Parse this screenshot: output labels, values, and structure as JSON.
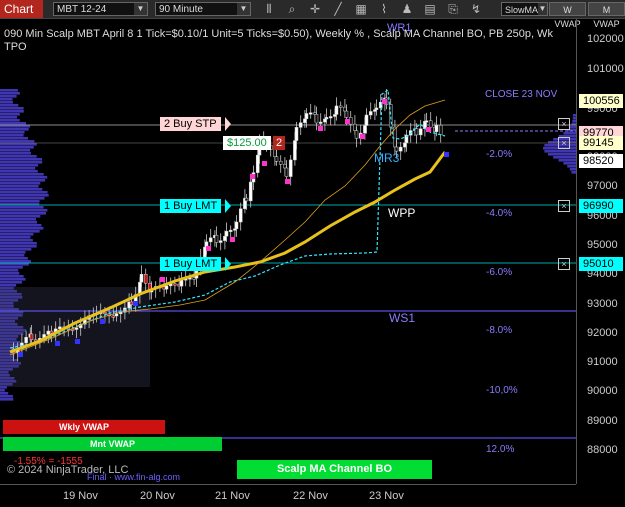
{
  "toolbar": {
    "chart_tab": "Chart",
    "instrument": "MBT 12-24",
    "interval": "90 Minute",
    "slow_ma": "SlowMA",
    "w_vwap": "W VWAP",
    "m_vwap": "M VWAP"
  },
  "title": {
    "line1": "090 Min Scalp MBT April 8 1 Tick=$0.10/1 Unit=5 Ticks=$0.50), Weekly % , Scalp MA Channel BO, PB 250p, Wk",
    "line2": "TPO"
  },
  "price_axis": {
    "labels": [
      "102000",
      "101000",
      "99000",
      "98000",
      "97000",
      "96000",
      "95000",
      "94000",
      "93000",
      "92000",
      "91000",
      "90000",
      "89000",
      "88000"
    ],
    "tags": [
      {
        "text": "100556",
        "color": "#ffffcc"
      },
      {
        "text": "99770",
        "color": "#ffd5d5"
      },
      {
        "text": "99145",
        "color": "#ffffcc"
      },
      {
        "text": "98520",
        "color": "#ffffff"
      },
      {
        "text": "96990",
        "color": "#00ffff"
      },
      {
        "text": "95010",
        "color": "#00ffff"
      }
    ]
  },
  "time_axis": [
    "19 Nov",
    "20 Nov",
    "21 Nov",
    "22 Nov",
    "23 Nov"
  ],
  "orders": {
    "buy_stp": "2 Buy STP",
    "buy_lmt_1": "1 Buy LMT",
    "buy_lmt_2": "1 Buy LMT",
    "pnl": "$125.00",
    "pnl_qty": "2"
  },
  "levels": {
    "wr1": "WR1",
    "mr3": "MR3",
    "wpp": "WPP",
    "ws1": "WS1",
    "close": "CLOSE 23 NOV",
    "pct_m2": "-2.0%",
    "pct_m4": "-4.0%",
    "pct_m6": "-6.0%",
    "pct_m8": "-8.0%",
    "pct_m10": "-10,0%",
    "pct_12": "12.0%"
  },
  "bottom": {
    "wkly_vwap": "Wkly VWAP",
    "mnt_vwap": "Mnt VWAP",
    "channel_bo": "Scalp MA Channel BO",
    "pct_text": "-1.55% = -1555",
    "copyright": "© 2024 NinjaTrader, LLC",
    "finalgo": "Final · www.fin-alg.com"
  },
  "colors": {
    "accent_red": "#b3261e",
    "cyan": "#00ffff",
    "vwap_green": "#00cc33",
    "profile_blue": "#4b3fd0",
    "ma_yellow": "#e8c21c"
  }
}
